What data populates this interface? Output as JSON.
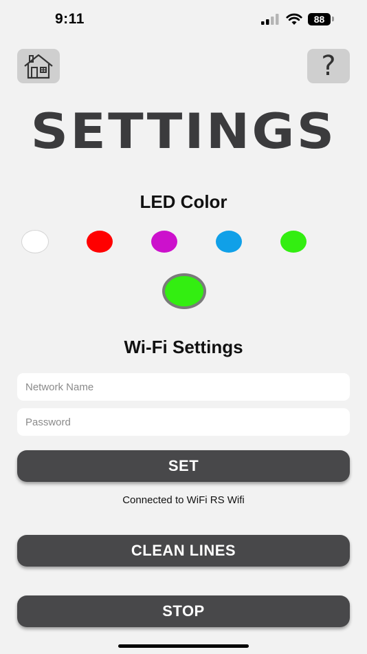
{
  "status_bar": {
    "time": "9:11",
    "battery": "88",
    "icons": [
      "signal-icon",
      "wifi-icon",
      "battery-icon"
    ]
  },
  "nav": {
    "home_icon": "house-icon",
    "help_label": "?"
  },
  "title": "SETTINGS",
  "led": {
    "heading": "LED Color",
    "colors": [
      {
        "name": "white",
        "hex": "#ffffff"
      },
      {
        "name": "red",
        "hex": "#ff0000"
      },
      {
        "name": "magenta",
        "hex": "#cc11cc"
      },
      {
        "name": "blue",
        "hex": "#10a0e8"
      },
      {
        "name": "green",
        "hex": "#33ee11"
      }
    ],
    "selected_hex": "#33ee11"
  },
  "wifi": {
    "heading": "Wi-Fi Settings",
    "network_placeholder": "Network Name",
    "network_value": "",
    "password_placeholder": "Password",
    "password_value": "",
    "set_label": "SET",
    "status": "Connected to WiFi RS Wifi"
  },
  "actions": {
    "clean_label": "CLEAN LINES",
    "stop_label": "STOP"
  },
  "theme": {
    "background": "#f2f2f2",
    "button": "#48484a",
    "title": "#3b3b3d"
  }
}
